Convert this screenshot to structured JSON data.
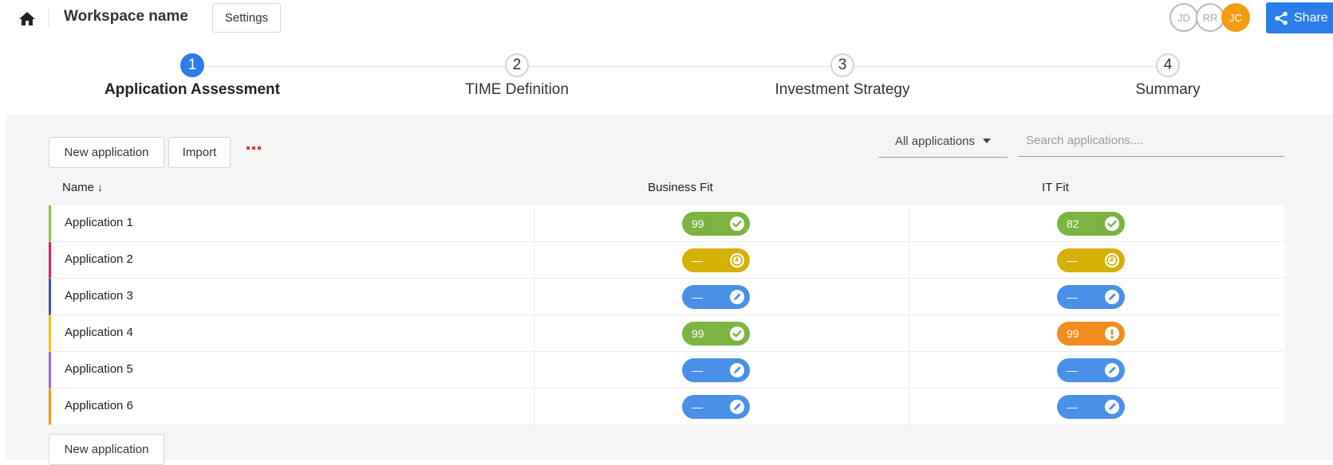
{
  "topbar": {
    "workspace_name": "Workspace name",
    "settings_label": "Settings",
    "avatars": [
      "JD",
      "RR",
      "JC"
    ],
    "share_label": "Share",
    "home_icon": "home-icon",
    "share_icon": "share-icon"
  },
  "stepper": {
    "steps": [
      {
        "number": "1",
        "label": "Application Assessment",
        "active": true
      },
      {
        "number": "2",
        "label": "TIME Definition",
        "active": false
      },
      {
        "number": "3",
        "label": "Investment Strategy",
        "active": false
      },
      {
        "number": "4",
        "label": "Summary",
        "active": false
      }
    ]
  },
  "toolbar": {
    "new_application_label": "New application",
    "import_label": "Import",
    "more_icon": "more-dots-icon",
    "filter_label": "All applications",
    "search_placeholder": "Search applications...."
  },
  "table": {
    "headers": {
      "name": "Name",
      "business_fit": "Business Fit",
      "it_fit": "IT Fit"
    },
    "sort_indicator": "↓",
    "rows": [
      {
        "name": "Application 1",
        "color": "#8bc34a",
        "business_fit": {
          "value": "99",
          "status": "complete"
        },
        "it_fit": {
          "value": "82",
          "status": "complete"
        }
      },
      {
        "name": "Application 2",
        "color": "#e91e63",
        "business_fit": {
          "value": "—",
          "status": "pending"
        },
        "it_fit": {
          "value": "—",
          "status": "pending"
        }
      },
      {
        "name": "Application 3",
        "color": "#3f51b5",
        "business_fit": {
          "value": "—",
          "status": "edit"
        },
        "it_fit": {
          "value": "—",
          "status": "edit"
        }
      },
      {
        "name": "Application 4",
        "color": "#f1c40f",
        "business_fit": {
          "value": "99",
          "status": "complete"
        },
        "it_fit": {
          "value": "99",
          "status": "warning"
        }
      },
      {
        "name": "Application 5",
        "color": "#9c6ade",
        "business_fit": {
          "value": "—",
          "status": "edit"
        },
        "it_fit": {
          "value": "—",
          "status": "edit"
        }
      },
      {
        "name": "Application 6",
        "color": "#f39c12",
        "business_fit": {
          "value": "—",
          "status": "edit"
        },
        "it_fit": {
          "value": "—",
          "status": "edit"
        }
      }
    ],
    "bottom_new_application_label": "New application"
  },
  "status_colors": {
    "complete": "#7cb342",
    "pending": "#d4b106",
    "edit": "#4a90e8",
    "warning": "#f28c1f"
  },
  "status_icons": {
    "complete": "check-circle-icon",
    "pending": "clock-icon",
    "edit": "pencil-icon",
    "warning": "exclamation-icon"
  },
  "colors": {
    "accent": "#2b7de9",
    "avatar_active": "#f39c12"
  }
}
